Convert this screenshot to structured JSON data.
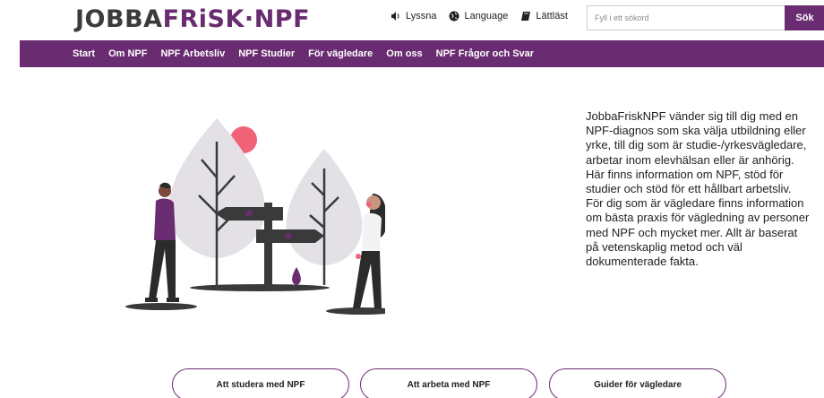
{
  "logo": {
    "part1": "JOBBA",
    "part2": "FRiSK",
    "dot": "·",
    "part3": "NPF"
  },
  "tools": {
    "listen": "Lyssna",
    "language": "Language",
    "easy_read": "Lättläst"
  },
  "search": {
    "placeholder": "Fyll i ett sökord",
    "button": "Sök"
  },
  "nav": {
    "items": [
      "Start",
      "Om NPF",
      "NPF Arbetsliv",
      "NPF Studier",
      "För vägledare",
      "Om oss",
      "NPF Frågor och Svar"
    ]
  },
  "intro": {
    "text": "JobbaFriskNPF vänder sig till dig med en NPF-diagnos som ska välja utbildning eller yrke, till dig som är studie-/yrkesvägledare, arbetar inom elevhälsan eller är anhörig. Här finns information om NPF, stöd för studier och stöd för ett hållbart arbetsliv. För dig som är vägledare finns information om bästa praxis för vägledning av personer med NPF och mycket mer. Allt är baserat på vetenskaplig metod och väl dokumenterade fakta."
  },
  "buttons": {
    "study": "Att studera med NPF",
    "work": "Att arbeta med NPF",
    "guides": "Guider för vägledare"
  },
  "colors": {
    "brand": "#6a2c70",
    "accent_pink": "#f06277"
  },
  "icons": {
    "listen": "speaker-icon",
    "language": "globe-icon",
    "easy_read": "book-icon"
  }
}
